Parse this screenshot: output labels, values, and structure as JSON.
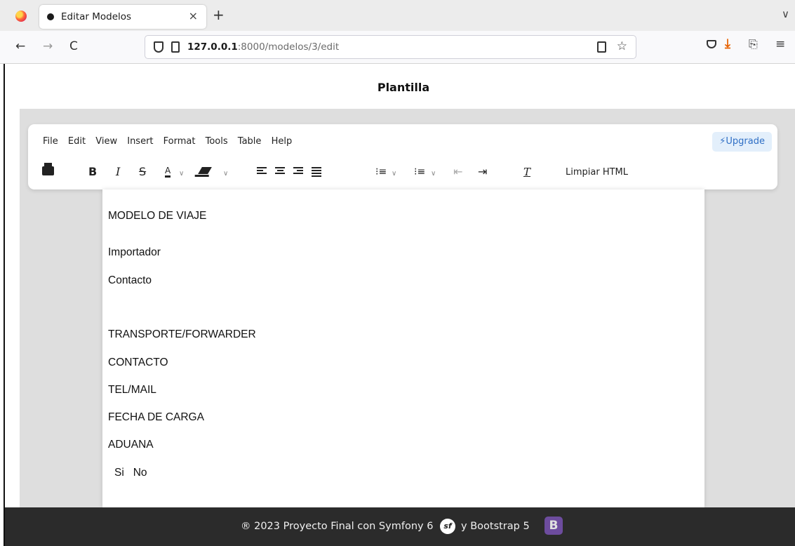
{
  "browser": {
    "tab_title": "Editar Modelos",
    "tab_close": "×",
    "new_tab": "+",
    "tab_list": "∨",
    "url_host": "127.0.0.1",
    "url_path": ":8000/modelos/3/edit",
    "back": "←",
    "forward": "→",
    "reload": "C",
    "star": "☆",
    "download": "⤓",
    "extensions": "⎘",
    "menu": "≡"
  },
  "page": {
    "title": "Plantilla"
  },
  "editor": {
    "menu": [
      "File",
      "Edit",
      "View",
      "Insert",
      "Format",
      "Tools",
      "Table",
      "Help"
    ],
    "upgrade_label": "⚡Upgrade",
    "toolbar": {
      "bold": "B",
      "italic": "I",
      "strike": "S",
      "text_color": "A",
      "chevron": "∨",
      "numbered_list": "⁝≡",
      "bullet_list": "⁝≡",
      "outdent": "⇤",
      "indent": "⇥",
      "clear_format": "T",
      "limpiar_html": "Limpiar HTML"
    },
    "content": [
      "MODELO DE VIAJE",
      "Importador",
      "Contacto",
      "TRANSPORTE/FORWARDER",
      "CONTACTO",
      "TEL/MAIL",
      "FECHA DE CARGA",
      "ADUANA",
      "Si   No"
    ]
  },
  "footer": {
    "text": "® 2023 Proyecto Final con Symfony 6",
    "symfony_mark": "sf",
    "text2": "y Bootstrap 5",
    "bootstrap_mark": "B"
  },
  "colors": {
    "accent": "#2f6fc5",
    "footer_bg": "#2b2b2b",
    "editor_bg": "#dedede",
    "download_orange": "#e66000"
  }
}
